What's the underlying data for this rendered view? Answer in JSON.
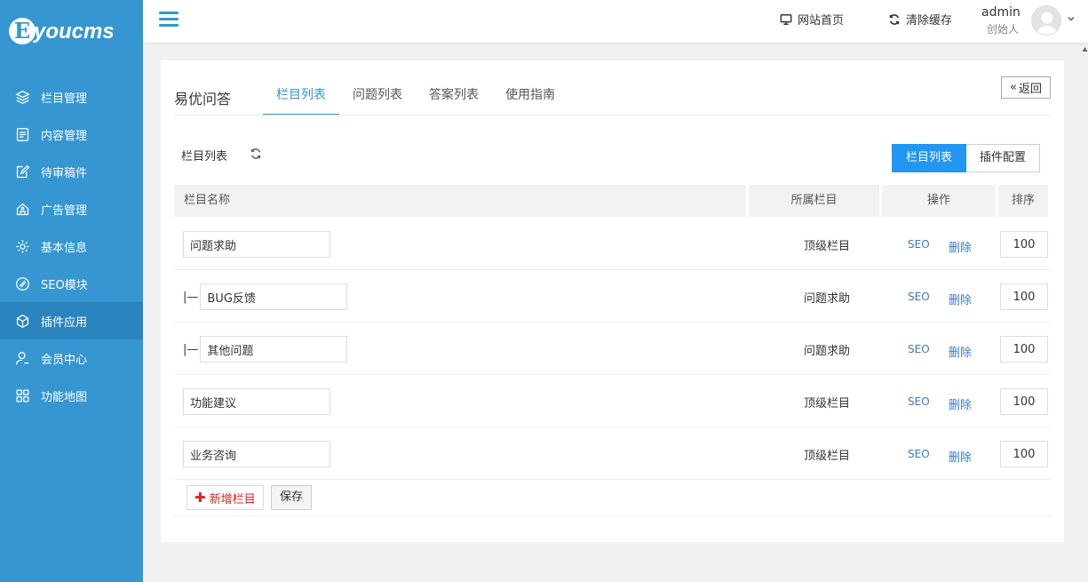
{
  "brand": {
    "logo_letter": "E",
    "logo_text": "youcms"
  },
  "sidebar": {
    "items": [
      {
        "label": "栏目管理",
        "icon": "layers-icon"
      },
      {
        "label": "内容管理",
        "icon": "document-icon"
      },
      {
        "label": "待审稿件",
        "icon": "edit-icon"
      },
      {
        "label": "广告管理",
        "icon": "ad-icon"
      },
      {
        "label": "基本信息",
        "icon": "gear-icon"
      },
      {
        "label": "SEO模块",
        "icon": "seo-icon"
      },
      {
        "label": "插件应用",
        "icon": "cube-icon"
      },
      {
        "label": "会员中心",
        "icon": "user-icon"
      },
      {
        "label": "功能地图",
        "icon": "grid-icon"
      }
    ],
    "active_index": 6
  },
  "topbar": {
    "site_home": "网站首页",
    "clear_cache": "清除缓存",
    "user_name": "admin",
    "user_role": "创始人"
  },
  "panel": {
    "title": "易优问答",
    "tabs": [
      "栏目列表",
      "问题列表",
      "答案列表",
      "使用指南"
    ],
    "active_tab": 0,
    "back_label": "返回",
    "sub_title": "栏目列表",
    "segments": [
      "栏目列表",
      "插件配置"
    ],
    "active_segment": 0
  },
  "table": {
    "headers": [
      "栏目名称",
      "所属栏目",
      "操作",
      "排序"
    ],
    "seo_label": "SEO",
    "delete_label": "删除",
    "rows": [
      {
        "prefix": "",
        "name": "问题求助",
        "parent": "顶级栏目",
        "sort": "100"
      },
      {
        "prefix": "|—",
        "name": "BUG反馈",
        "parent": "问题求助",
        "sort": "100"
      },
      {
        "prefix": "|—",
        "name": "其他问题",
        "parent": "问题求助",
        "sort": "100"
      },
      {
        "prefix": "",
        "name": "功能建议",
        "parent": "顶级栏目",
        "sort": "100"
      },
      {
        "prefix": "",
        "name": "业务咨询",
        "parent": "顶级栏目",
        "sort": "100"
      }
    ]
  },
  "actions": {
    "add_label": "新增栏目",
    "save_label": "保存"
  },
  "colors": {
    "sidebar": "#3596d2",
    "sidebar_active": "#2a84bd",
    "primary": "#2196f3",
    "link": "#3a7ac3",
    "add_red": "#e02020"
  }
}
